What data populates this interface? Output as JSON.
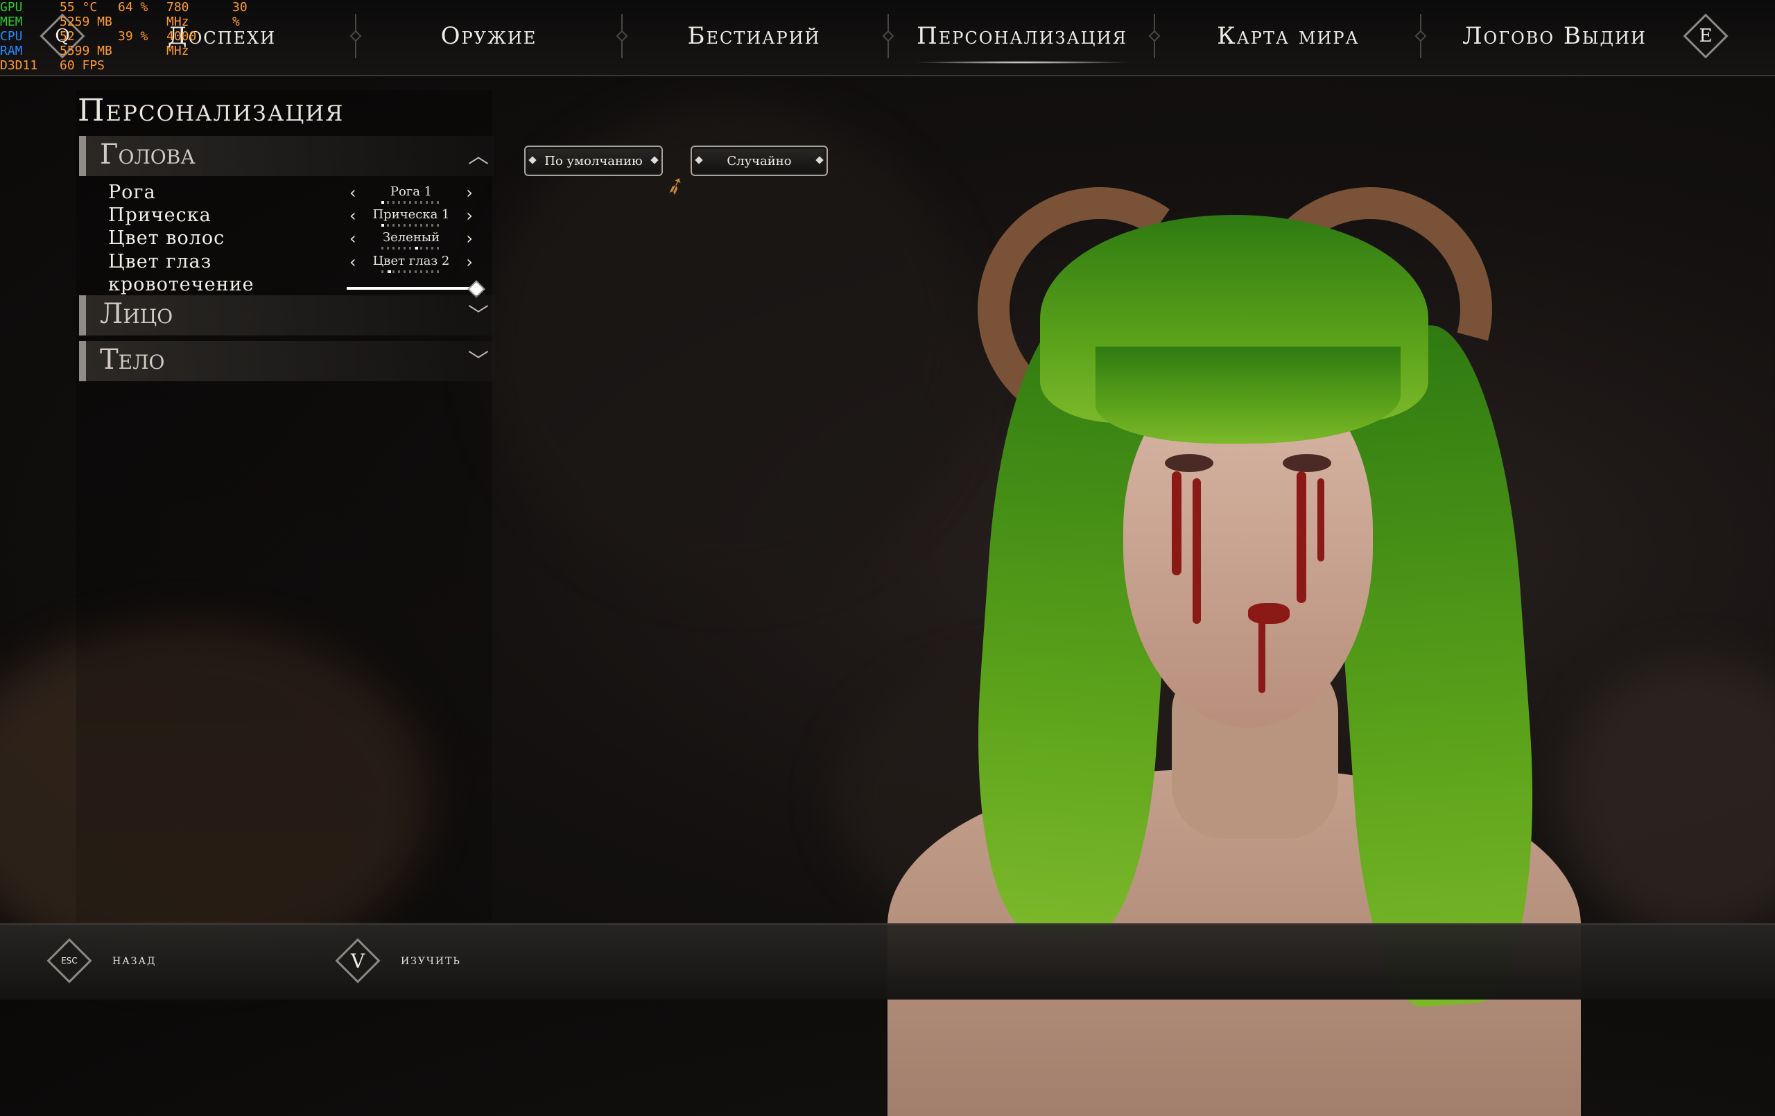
{
  "perf": {
    "rows": [
      {
        "label": "GPU",
        "label_color": "#32c832",
        "v1": "55 °C",
        "v2": "64 %",
        "v3": "780 MHz",
        "v4": "30 %"
      },
      {
        "label": "MEM",
        "label_color": "#32c832",
        "v1": "5259 MB",
        "v2": "",
        "v3": "",
        "v4": ""
      },
      {
        "label": "CPU",
        "label_color": "#2a8cff",
        "v1": "52",
        "v2": "39 %",
        "v3": "4000 MHz",
        "v4": ""
      },
      {
        "label": "RAM",
        "label_color": "#2a8cff",
        "v1": "5599 MB",
        "v2": "",
        "v3": "",
        "v4": ""
      },
      {
        "label": "D3D11",
        "label_color": "#ff9a30",
        "v1": "60 FPS",
        "v2": "",
        "v3": "",
        "v4": ""
      }
    ]
  },
  "nav": {
    "tabs": [
      {
        "label": "Доспехи"
      },
      {
        "label": "Оружие"
      },
      {
        "label": "Бестиарий"
      },
      {
        "label": "Персонализация",
        "active": true
      },
      {
        "label": "Карта мира"
      },
      {
        "label": "Логово Выдии"
      }
    ],
    "prev_key": "Q",
    "next_key": "E"
  },
  "panel": {
    "title": "Персонализация",
    "sections": [
      {
        "label": "Голова",
        "expanded": true
      },
      {
        "label": "Лицо",
        "expanded": false
      },
      {
        "label": "Тело",
        "expanded": false
      }
    ],
    "head_options": [
      {
        "label": "Рога",
        "value": "Рога 1",
        "index": 1,
        "count": 10
      },
      {
        "label": "Прическа",
        "value": "Прическа 1",
        "index": 1,
        "count": 10
      },
      {
        "label": "Цвет волос",
        "value": "Зеленый",
        "index": 5,
        "count": 8
      },
      {
        "label": "Цвет глаз",
        "value": "Цвет глаз 2",
        "index": 2,
        "count": 10
      }
    ],
    "slider": {
      "label": "кровотечение",
      "value": 1.0
    }
  },
  "buttons": {
    "default_label": "По умолчанию",
    "random_label": "Случайно"
  },
  "bottom": {
    "back_key": "ESC",
    "back_label": "назад",
    "inspect_key": "V",
    "inspect_label": "изучить"
  },
  "colors": {
    "accent": "#ffffff",
    "hair": "#4e9a18",
    "blood": "#8b1a16"
  }
}
